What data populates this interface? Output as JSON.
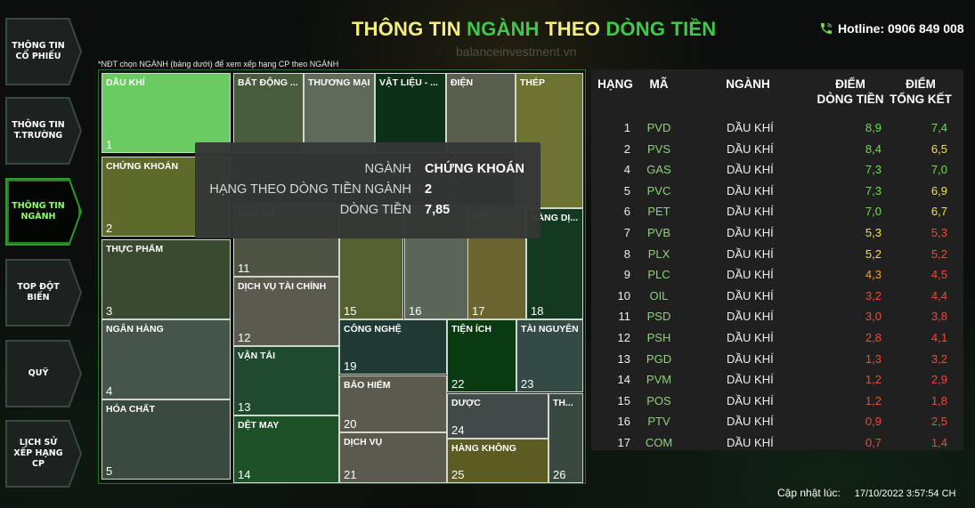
{
  "header": {
    "title_part1": "THÔNG TIN ",
    "title_part2": "NGÀNH",
    "title_part3": " THEO ",
    "title_part4": "DÒNG TIỀN",
    "watermark": "balanceinvestment.vn",
    "hotline": "Hotline: 0906 849 008",
    "hint": "*NĐT chọn NGÀNH (bảng dưới) để xem xếp hạng CP theo NGÀNH"
  },
  "sidebar": {
    "items": [
      {
        "label": "THÔNG TIN CỔ PHIẾU",
        "active": false
      },
      {
        "label": "THÔNG TIN T.TRƯỜNG",
        "active": false
      },
      {
        "label": "THÔNG TIN NGÀNH",
        "active": true
      },
      {
        "label": "TOP ĐỘT BIẾN",
        "active": false
      },
      {
        "label": "QUỸ",
        "active": false
      },
      {
        "label": "LỊCH SỬ XẾP HẠNG CP",
        "active": false
      }
    ]
  },
  "treemap": {
    "tiles": [
      {
        "label": "DẦU KHÍ",
        "num": "1",
        "color": "#6bcb63"
      },
      {
        "label": "CHỨNG KHOÁN",
        "num": "2",
        "color": "#5d6a2a"
      },
      {
        "label": "THỰC PHẨM",
        "num": "3",
        "color": "#3a4a30"
      },
      {
        "label": "NGÂN HÀNG",
        "num": "4",
        "color": "#46554a"
      },
      {
        "label": "HÓA CHẤT",
        "num": "5",
        "color": "#3b4a3e"
      },
      {
        "label": "BẤT ĐỘNG ...",
        "num": "",
        "color": "#4a5c3e"
      },
      {
        "label": "THƯƠNG MẠI",
        "num": "",
        "color": "#5e6a5a"
      },
      {
        "label": "VẬT LIỆU - ...",
        "num": "",
        "color": "#0f3018"
      },
      {
        "label": "ĐIỆN",
        "num": "",
        "color": "#5a5e4e"
      },
      {
        "label": "THÉP",
        "num": "",
        "color": "#6b7232"
      },
      {
        "label": "CAO SU",
        "num": "11",
        "color": "#4e5444"
      },
      {
        "label": "",
        "num": "15",
        "color": "#54602e"
      },
      {
        "label": "",
        "num": "16",
        "color": "#5c6658"
      },
      {
        "label": "DẦU",
        "num": "17",
        "color": "#6a6430"
      },
      {
        "label": "HÀNG DỊ...",
        "num": "18",
        "color": "#133a20"
      },
      {
        "label": "DỊCH VỤ TÀI CHÍNH",
        "num": "12",
        "color": "#5a5a4e"
      },
      {
        "label": "VẬN TẢI",
        "num": "13",
        "color": "#1f4a30"
      },
      {
        "label": "DỆT MAY",
        "num": "14",
        "color": "#1c5226"
      },
      {
        "label": "CÔNG NGHỆ",
        "num": "19",
        "color": "#1e3a33"
      },
      {
        "label": "BẢO HIỂM",
        "num": "20",
        "color": "#5a5a4e"
      },
      {
        "label": "DỊCH VỤ",
        "num": "21",
        "color": "#5a5a4e"
      },
      {
        "label": "TIỆN ÍCH",
        "num": "22",
        "color": "#0a3a12"
      },
      {
        "label": "TÀI NGUYÊN",
        "num": "23",
        "color": "#344a44"
      },
      {
        "label": "DƯỢC",
        "num": "24",
        "color": "#414a48"
      },
      {
        "label": "HÀNG KHÔNG",
        "num": "25",
        "color": "#5c5b22"
      },
      {
        "label": "TH...",
        "num": "26",
        "color": "#394840"
      }
    ]
  },
  "tooltip": {
    "rows": [
      {
        "key": "NGÀNH",
        "value": "CHỨNG KHOÁN"
      },
      {
        "key": "HẠNG THEO DÒNG TIỀN NGÀNH",
        "value": "2"
      },
      {
        "key": "DÒNG TIỀN",
        "value": "7,85"
      }
    ]
  },
  "table": {
    "headers": {
      "rank": "HẠNG",
      "code": "MÃ",
      "sector": "NGÀNH",
      "flow_line1": "ĐIỂM",
      "flow_line2": "DÒNG TIỀN",
      "total_line1": "ĐIỂM",
      "total_line2": "TỔNG KẾT"
    },
    "rows": [
      {
        "rank": "1",
        "code": "PVD",
        "sector": "DẦU KHÍ",
        "flow": "8,9",
        "total": "7,4",
        "flow_color": "#6fe04a",
        "total_color": "#6fe04a"
      },
      {
        "rank": "2",
        "code": "PVS",
        "sector": "DẦU KHÍ",
        "flow": "8,4",
        "total": "6,5",
        "flow_color": "#6fe04a",
        "total_color": "#f2e24a"
      },
      {
        "rank": "4",
        "code": "GAS",
        "sector": "DẦU KHÍ",
        "flow": "7,3",
        "total": "7,0",
        "flow_color": "#6fe04a",
        "total_color": "#6fe04a"
      },
      {
        "rank": "5",
        "code": "PVC",
        "sector": "DẦU KHÍ",
        "flow": "7,3",
        "total": "6,9",
        "flow_color": "#6fe04a",
        "total_color": "#f2e24a"
      },
      {
        "rank": "6",
        "code": "PET",
        "sector": "DẦU KHÍ",
        "flow": "7,0",
        "total": "6,7",
        "flow_color": "#6fe04a",
        "total_color": "#f2e24a"
      },
      {
        "rank": "7",
        "code": "PVB",
        "sector": "DẦU KHÍ",
        "flow": "5,3",
        "total": "5,3",
        "flow_color": "#f2e24a",
        "total_color": "#f04a3a"
      },
      {
        "rank": "8",
        "code": "PLX",
        "sector": "DẦU KHÍ",
        "flow": "5,2",
        "total": "5,2",
        "flow_color": "#f2e24a",
        "total_color": "#f04a3a"
      },
      {
        "rank": "9",
        "code": "PLC",
        "sector": "DẦU KHÍ",
        "flow": "4,3",
        "total": "4,5",
        "flow_color": "#f0a030",
        "total_color": "#f04a3a"
      },
      {
        "rank": "10",
        "code": "OIL",
        "sector": "DẦU KHÍ",
        "flow": "3,2",
        "total": "4,4",
        "flow_color": "#f04a3a",
        "total_color": "#f04a3a"
      },
      {
        "rank": "11",
        "code": "PSD",
        "sector": "DẦU KHÍ",
        "flow": "3,0",
        "total": "3,8",
        "flow_color": "#f04a3a",
        "total_color": "#f04a3a"
      },
      {
        "rank": "12",
        "code": "PSH",
        "sector": "DẦU KHÍ",
        "flow": "2,8",
        "total": "4,1",
        "flow_color": "#f04a3a",
        "total_color": "#f04a3a"
      },
      {
        "rank": "13",
        "code": "PGD",
        "sector": "DẦU KHÍ",
        "flow": "1,3",
        "total": "3,2",
        "flow_color": "#f04a3a",
        "total_color": "#f04a3a"
      },
      {
        "rank": "14",
        "code": "PVM",
        "sector": "DẦU KHÍ",
        "flow": "1,2",
        "total": "2,9",
        "flow_color": "#f04a3a",
        "total_color": "#f04a3a"
      },
      {
        "rank": "15",
        "code": "POS",
        "sector": "DẦU KHÍ",
        "flow": "1,2",
        "total": "1,8",
        "flow_color": "#f04a3a",
        "total_color": "#f04a3a"
      },
      {
        "rank": "16",
        "code": "PTV",
        "sector": "DẦU KHÍ",
        "flow": "0,9",
        "total": "2,5",
        "flow_color": "#f04a3a",
        "total_color": "#f04a3a"
      },
      {
        "rank": "17",
        "code": "COM",
        "sector": "DẦU KHÍ",
        "flow": "0,7",
        "total": "1,4",
        "flow_color": "#f04a3a",
        "total_color": "#f04a3a"
      }
    ]
  },
  "footer": {
    "updated_label": "Cập nhật lúc:",
    "updated_value": "17/10/2022 3:57:54 CH"
  }
}
